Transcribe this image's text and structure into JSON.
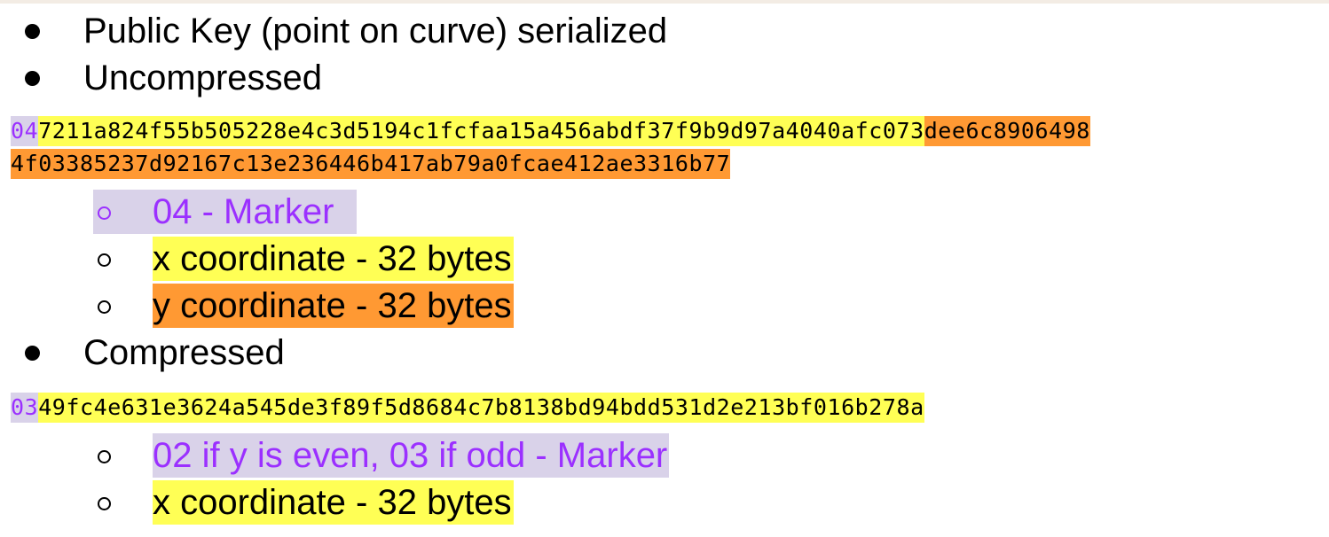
{
  "bullets": {
    "public_key": "Public Key (point on curve) serialized",
    "uncompressed": "Uncompressed",
    "compressed": "Compressed"
  },
  "uncompressed": {
    "line1": {
      "marker": "04",
      "x": "7211a824f55b505228e4c3d5194c1fcfaa15a456abdf37f9b9d97a4040afc073",
      "y_start": "dee6c8906498"
    },
    "line2": {
      "y_end": "4f03385237d92167c13e236446b417ab79a0fcae412ae3316b77"
    },
    "items": [
      "04 - Marker",
      "x coordinate - 32 bytes",
      "y coordinate - 32 bytes"
    ]
  },
  "compressed": {
    "line": {
      "marker": "03",
      "x": "49fc4e631e3624a545de3f89f5d8684c7b8138bd94bdd531d2e213bf016b278a"
    },
    "items": [
      "02 if y is even, 03 if odd - Marker",
      "x coordinate - 32 bytes"
    ]
  },
  "colors": {
    "marker_text": "#9b30ff",
    "marker_bg": "#d9d2e9",
    "x_bg": "#ffff55",
    "y_bg": "#ff9933"
  }
}
